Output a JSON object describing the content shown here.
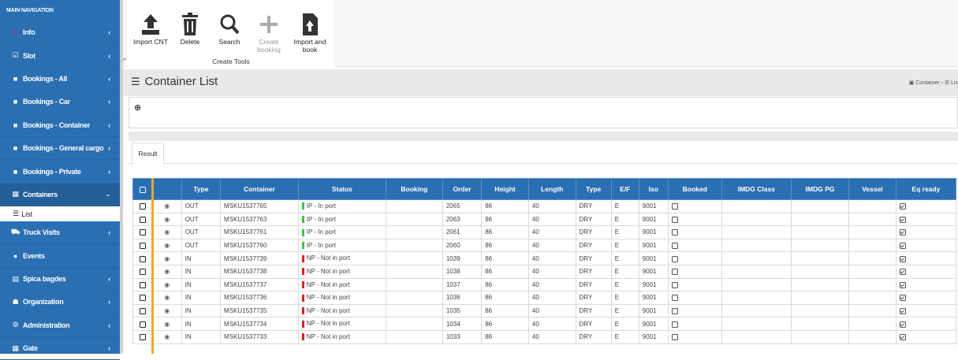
{
  "sidebar": {
    "header": "MAIN NAVIGATION",
    "items": [
      {
        "label": "Info",
        "icon": "warning-icon",
        "glyph": "⚠",
        "chev": "‹",
        "cls": "info"
      },
      {
        "label": "Slot",
        "icon": "calendar-check-icon",
        "glyph": "☑",
        "chev": "‹"
      },
      {
        "label": "Bookings - All",
        "icon": "folder-icon",
        "glyph": "■",
        "chev": "‹"
      },
      {
        "label": "Bookings - Car",
        "icon": "folder-icon",
        "glyph": "■",
        "chev": "‹"
      },
      {
        "label": "Bookings - Container",
        "icon": "folder-icon",
        "glyph": "■",
        "chev": "‹"
      },
      {
        "label": "Bookings - General cargo",
        "icon": "folder-icon",
        "glyph": "■",
        "chev": "‹"
      },
      {
        "label": "Bookings - Private",
        "icon": "folder-icon",
        "glyph": "■",
        "chev": "‹"
      },
      {
        "label": "Containers",
        "icon": "grid-icon",
        "glyph": "▦",
        "chev": "⌄",
        "active": true
      },
      {
        "label": "Truck Visits",
        "icon": "truck-icon",
        "glyph": "⛟",
        "chev": "‹"
      },
      {
        "label": "Events",
        "icon": "info-circle-icon",
        "glyph": "●",
        "chev": ""
      },
      {
        "label": "Spica bagdes",
        "icon": "id-card-icon",
        "glyph": "▤",
        "chev": "‹"
      },
      {
        "label": "Organization",
        "icon": "users-icon",
        "glyph": "☗",
        "chev": "‹"
      },
      {
        "label": "Administration",
        "icon": "cogs-icon",
        "glyph": "⚙",
        "chev": "‹"
      },
      {
        "label": "Gate",
        "icon": "grid-icon",
        "glyph": "▦",
        "chev": "‹"
      }
    ],
    "sub_item": {
      "label": "List",
      "icon": "list-icon",
      "glyph": "☰"
    }
  },
  "toolbar": {
    "buttons": [
      {
        "label": "Import CNT",
        "icon": "upload-icon",
        "glyph": "⬆",
        "disabled": false
      },
      {
        "label": "Delete",
        "icon": "trash-icon",
        "glyph": "🗑",
        "disabled": false
      },
      {
        "label": "Search",
        "icon": "search-icon",
        "glyph": "🔍",
        "disabled": false
      },
      {
        "label": "Create booking",
        "icon": "plus-icon",
        "glyph": "+",
        "disabled": true
      },
      {
        "label": "Import and book",
        "icon": "file-upload-icon",
        "glyph": "📄",
        "disabled": false
      }
    ],
    "group_label": "Create Tools",
    "collapse_glyph": "^"
  },
  "page": {
    "title": "Container List",
    "title_glyph": "☰",
    "breadcrumb": "▣ Container  ›  ☰ Lis"
  },
  "search": {
    "zoom_glyph": "⊕"
  },
  "tabs": [
    {
      "label": "Result"
    }
  ],
  "table": {
    "headers": [
      "",
      "",
      "Type",
      "Container",
      "Status",
      "Booking",
      "Order",
      "Height",
      "Length",
      "Type",
      "E/F",
      "Iso",
      "Booked",
      "IMDG Class",
      "IMDG PG",
      "Vessel",
      "Eq ready"
    ],
    "status_colors": {
      "IP - In port": "#2ecc40",
      "NP - Not in port": "#e02020"
    },
    "rows": [
      {
        "type": "OUT",
        "container": "MSKU1537765",
        "status": "IP - In port",
        "booking": "",
        "order": "2065",
        "height": "86",
        "length": "40",
        "ctype": "DRY",
        "ef": "E",
        "iso": "9001",
        "imdg_class": "",
        "imdg_pg": "",
        "vessel": ""
      },
      {
        "type": "OUT",
        "container": "MSKU1537763",
        "status": "IP - In port",
        "booking": "",
        "order": "2063",
        "height": "86",
        "length": "40",
        "ctype": "DRY",
        "ef": "E",
        "iso": "9001",
        "imdg_class": "",
        "imdg_pg": "",
        "vessel": ""
      },
      {
        "type": "OUT",
        "container": "MSKU1537761",
        "status": "IP - In port",
        "booking": "",
        "order": "2061",
        "height": "86",
        "length": "40",
        "ctype": "DRY",
        "ef": "E",
        "iso": "9001",
        "imdg_class": "",
        "imdg_pg": "",
        "vessel": ""
      },
      {
        "type": "OUT",
        "container": "MSKU1537760",
        "status": "IP - In port",
        "booking": "",
        "order": "2060",
        "height": "86",
        "length": "40",
        "ctype": "DRY",
        "ef": "E",
        "iso": "9001",
        "imdg_class": "",
        "imdg_pg": "",
        "vessel": ""
      },
      {
        "type": "IN",
        "container": "MSKU1537739",
        "status": "NP - Not in port",
        "booking": "",
        "order": "1039",
        "height": "86",
        "length": "40",
        "ctype": "DRY",
        "ef": "E",
        "iso": "9001",
        "imdg_class": "",
        "imdg_pg": "",
        "vessel": ""
      },
      {
        "type": "IN",
        "container": "MSKU1537738",
        "status": "NP - Not in port",
        "booking": "",
        "order": "1038",
        "height": "86",
        "length": "40",
        "ctype": "DRY",
        "ef": "E",
        "iso": "9001",
        "imdg_class": "",
        "imdg_pg": "",
        "vessel": ""
      },
      {
        "type": "IN",
        "container": "MSKU1537737",
        "status": "NP - Not in port",
        "booking": "",
        "order": "1037",
        "height": "86",
        "length": "40",
        "ctype": "DRY",
        "ef": "E",
        "iso": "9001",
        "imdg_class": "",
        "imdg_pg": "",
        "vessel": ""
      },
      {
        "type": "IN",
        "container": "MSKU1537736",
        "status": "NP - Not in port",
        "booking": "",
        "order": "1036",
        "height": "86",
        "length": "40",
        "ctype": "DRY",
        "ef": "E",
        "iso": "9001",
        "imdg_class": "",
        "imdg_pg": "",
        "vessel": ""
      },
      {
        "type": "IN",
        "container": "MSKU1537735",
        "status": "NP - Not in port",
        "booking": "",
        "order": "1035",
        "height": "86",
        "length": "40",
        "ctype": "DRY",
        "ef": "E",
        "iso": "9001",
        "imdg_class": "",
        "imdg_pg": "",
        "vessel": ""
      },
      {
        "type": "IN",
        "container": "MSKU1537734",
        "status": "NP - Not in port",
        "booking": "",
        "order": "1034",
        "height": "86",
        "length": "40",
        "ctype": "DRY",
        "ef": "E",
        "iso": "9001",
        "imdg_class": "",
        "imdg_pg": "",
        "vessel": ""
      },
      {
        "type": "IN",
        "container": "MSKU1537733",
        "status": "NP - Not in port",
        "booking": "",
        "order": "1033",
        "height": "86",
        "length": "40",
        "ctype": "DRY",
        "ef": "E",
        "iso": "9001",
        "imdg_class": "",
        "imdg_pg": "",
        "vessel": ""
      }
    ]
  }
}
